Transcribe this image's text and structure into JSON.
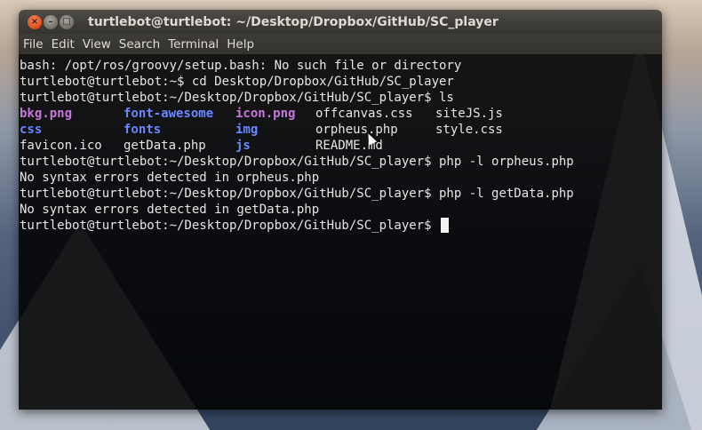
{
  "window": {
    "title": "turtlebot@turtlebot: ~/Desktop/Dropbox/GitHub/SC_player",
    "buttons": {
      "close": "×",
      "minimize": "–",
      "maximize": "□"
    }
  },
  "menubar": {
    "items": [
      "File",
      "Edit",
      "View",
      "Search",
      "Terminal",
      "Help"
    ]
  },
  "terminal": {
    "lines_before": [
      "bash: /opt/ros/groovy/setup.bash: No such file or directory",
      "turtlebot@turtlebot:~$ cd Desktop/Dropbox/GitHub/SC_player",
      "turtlebot@turtlebot:~/Desktop/Dropbox/GitHub/SC_player$ ls"
    ],
    "ls_rows": [
      [
        {
          "name": "bkg.png",
          "type": "image"
        },
        {
          "name": "font-awesome",
          "type": "directory"
        },
        {
          "name": "icon.png",
          "type": "image"
        },
        {
          "name": "offcanvas.css",
          "type": "file"
        },
        {
          "name": "siteJS.js",
          "type": "file"
        }
      ],
      [
        {
          "name": "css",
          "type": "directory"
        },
        {
          "name": "fonts",
          "type": "directory"
        },
        {
          "name": "img",
          "type": "directory"
        },
        {
          "name": "orpheus.php",
          "type": "file"
        },
        {
          "name": "style.css",
          "type": "file"
        }
      ],
      [
        {
          "name": "favicon.ico",
          "type": "file"
        },
        {
          "name": "getData.php",
          "type": "file"
        },
        {
          "name": "js",
          "type": "directory"
        },
        {
          "name": "README.md",
          "type": "file"
        },
        {
          "name": "",
          "type": "file"
        }
      ]
    ],
    "lines_after": [
      "turtlebot@turtlebot:~/Desktop/Dropbox/GitHub/SC_player$ php -l orpheus.php",
      "No syntax errors detected in orpheus.php",
      "turtlebot@turtlebot:~/Desktop/Dropbox/GitHub/SC_player$ php -l getData.php",
      "No syntax errors detected in getData.php"
    ],
    "prompt": "turtlebot@turtlebot:~/Desktop/Dropbox/GitHub/SC_player$ "
  },
  "colors": {
    "image_file": "#c678dd",
    "directory": "#6b87ff",
    "text": "#e6e6e6",
    "close_button": "#df4b16"
  }
}
